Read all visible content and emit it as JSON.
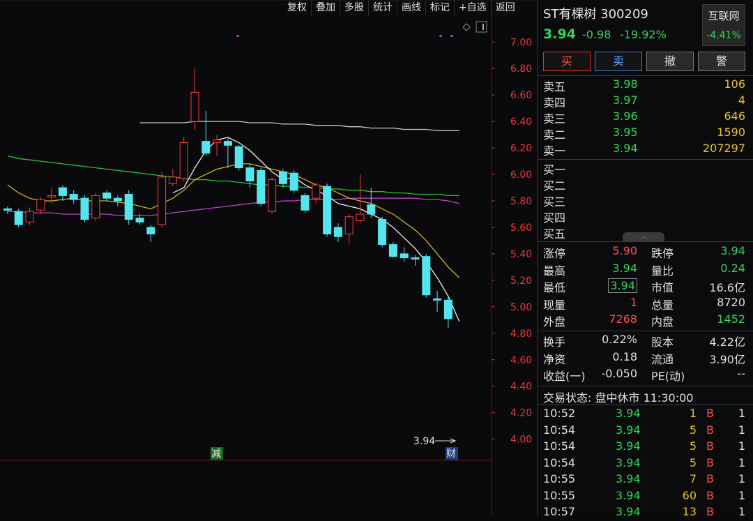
{
  "toolbar": [
    "复权",
    "叠加",
    "多股",
    "统计",
    "画线",
    "标记",
    "+自选",
    "返回"
  ],
  "chart_data": {
    "type": "candlestick",
    "y_ticks": [
      "7.00",
      "6.80",
      "6.60",
      "6.40",
      "6.20",
      "6.00",
      "5.80",
      "5.60",
      "5.40",
      "5.20",
      "5.00",
      "4.80",
      "4.60",
      "4.40",
      "4.20",
      "4.00"
    ],
    "ylim": [
      3.84,
      7.17
    ],
    "last_price_label": "3.94",
    "marker_left": "减",
    "marker_right": "财",
    "candles": [
      {
        "o": 5.74,
        "c": 5.73,
        "h": 5.76,
        "l": 5.7
      },
      {
        "o": 5.72,
        "c": 5.62,
        "h": 5.74,
        "l": 5.6
      },
      {
        "o": 5.64,
        "c": 5.72,
        "h": 5.75,
        "l": 5.62
      },
      {
        "o": 5.73,
        "c": 5.81,
        "h": 5.83,
        "l": 5.7
      },
      {
        "o": 5.83,
        "c": 5.84,
        "h": 5.9,
        "l": 5.78
      },
      {
        "o": 5.9,
        "c": 5.84,
        "h": 5.92,
        "l": 5.8
      },
      {
        "o": 5.85,
        "c": 5.81,
        "h": 5.88,
        "l": 5.78
      },
      {
        "o": 5.82,
        "c": 5.66,
        "h": 5.84,
        "l": 5.64
      },
      {
        "o": 5.67,
        "c": 5.84,
        "h": 5.86,
        "l": 5.65
      },
      {
        "o": 5.86,
        "c": 5.82,
        "h": 5.88,
        "l": 5.8
      },
      {
        "o": 5.82,
        "c": 5.8,
        "h": 5.84,
        "l": 5.76
      },
      {
        "o": 5.85,
        "c": 5.66,
        "h": 5.88,
        "l": 5.62
      },
      {
        "o": 5.67,
        "c": 5.64,
        "h": 5.7,
        "l": 5.62
      },
      {
        "o": 5.6,
        "c": 5.55,
        "h": 5.62,
        "l": 5.49
      },
      {
        "o": 5.62,
        "c": 5.98,
        "h": 6.02,
        "l": 5.6
      },
      {
        "o": 5.93,
        "c": 5.98,
        "h": 6.04,
        "l": 5.91
      },
      {
        "o": 5.97,
        "c": 6.24,
        "h": 6.28,
        "l": 5.95
      },
      {
        "o": 6.4,
        "c": 6.62,
        "h": 6.8,
        "l": 6.34
      },
      {
        "o": 6.25,
        "c": 6.16,
        "h": 6.48,
        "l": 6.14
      },
      {
        "o": 6.24,
        "c": 6.26,
        "h": 6.3,
        "l": 6.14
      },
      {
        "o": 6.25,
        "c": 6.22,
        "h": 6.28,
        "l": 6.05
      },
      {
        "o": 6.21,
        "c": 6.05,
        "h": 6.22,
        "l": 6.03
      },
      {
        "o": 6.05,
        "c": 5.95,
        "h": 6.08,
        "l": 5.9
      },
      {
        "o": 6.03,
        "c": 5.78,
        "h": 6.05,
        "l": 5.76
      },
      {
        "o": 5.72,
        "c": 5.96,
        "h": 5.98,
        "l": 5.7
      },
      {
        "o": 6.02,
        "c": 5.93,
        "h": 6.04,
        "l": 5.9
      },
      {
        "o": 6.01,
        "c": 5.88,
        "h": 6.03,
        "l": 5.86
      },
      {
        "o": 5.84,
        "c": 5.73,
        "h": 5.86,
        "l": 5.71
      },
      {
        "o": 5.82,
        "c": 5.92,
        "h": 5.94,
        "l": 5.78
      },
      {
        "o": 5.91,
        "c": 5.55,
        "h": 5.93,
        "l": 5.53
      },
      {
        "o": 5.6,
        "c": 5.53,
        "h": 5.63,
        "l": 5.49
      },
      {
        "o": 5.55,
        "c": 5.68,
        "h": 5.7,
        "l": 5.48
      },
      {
        "o": 5.65,
        "c": 5.7,
        "h": 6.0,
        "l": 5.63
      },
      {
        "o": 5.77,
        "c": 5.7,
        "h": 5.9,
        "l": 5.67
      },
      {
        "o": 5.66,
        "c": 5.47,
        "h": 5.68,
        "l": 5.45
      },
      {
        "o": 5.47,
        "c": 5.38,
        "h": 5.49,
        "l": 5.37
      },
      {
        "o": 5.4,
        "c": 5.37,
        "h": 5.45,
        "l": 5.34
      },
      {
        "o": 5.37,
        "c": 5.36,
        "h": 5.39,
        "l": 5.31
      },
      {
        "o": 5.38,
        "c": 5.09,
        "h": 5.4,
        "l": 5.07
      },
      {
        "o": 5.06,
        "c": 5.05,
        "h": 5.12,
        "l": 4.96
      },
      {
        "o": 5.05,
        "c": 4.91,
        "h": 5.08,
        "l": 4.84
      }
    ],
    "ma_white": [
      null,
      null,
      null,
      null,
      null,
      null,
      null,
      null,
      null,
      null,
      null,
      null,
      null,
      null,
      null,
      5.86,
      5.9,
      6.05,
      6.18,
      6.26,
      6.28,
      6.24,
      6.18,
      6.1,
      6.02,
      5.96,
      5.98,
      5.92,
      5.88,
      5.84,
      5.78,
      5.76,
      5.74,
      5.7,
      5.66,
      5.6,
      5.52,
      5.44,
      5.34,
      5.22,
      5.08,
      4.89
    ],
    "ma_yellow": [
      5.92,
      5.86,
      5.82,
      5.8,
      5.8,
      5.81,
      5.82,
      5.8,
      5.8,
      5.8,
      5.79,
      5.78,
      5.76,
      5.74,
      5.78,
      5.82,
      5.88,
      5.96,
      6.0,
      6.04,
      6.06,
      6.08,
      6.08,
      6.06,
      6.04,
      6.02,
      6.0,
      5.96,
      5.92,
      5.9,
      5.86,
      5.82,
      5.8,
      5.78,
      5.74,
      5.7,
      5.64,
      5.58,
      5.5,
      5.4,
      5.3,
      5.22
    ],
    "ma_green": [
      6.14,
      6.12,
      6.11,
      6.1,
      6.09,
      6.08,
      6.07,
      6.06,
      6.05,
      6.04,
      6.03,
      6.02,
      6.01,
      6.0,
      5.99,
      5.98,
      5.97,
      5.96,
      5.96,
      5.95,
      5.95,
      5.94,
      5.93,
      5.92,
      5.92,
      5.91,
      5.91,
      5.9,
      5.9,
      5.89,
      5.89,
      5.88,
      5.88,
      5.87,
      5.87,
      5.86,
      5.86,
      5.85,
      5.85,
      5.85,
      5.84,
      5.84
    ],
    "ma_purple": [
      5.72,
      5.72,
      5.71,
      5.71,
      5.71,
      5.7,
      5.7,
      5.7,
      5.7,
      5.7,
      5.69,
      5.69,
      5.69,
      5.69,
      5.7,
      5.71,
      5.72,
      5.73,
      5.74,
      5.75,
      5.76,
      5.77,
      5.78,
      5.79,
      5.79,
      5.8,
      5.8,
      5.81,
      5.81,
      5.81,
      5.81,
      5.82,
      5.82,
      5.82,
      5.82,
      5.82,
      5.82,
      5.82,
      5.81,
      5.81,
      5.8,
      5.78
    ],
    "ma_gray": [
      null,
      null,
      null,
      null,
      null,
      null,
      null,
      null,
      null,
      null,
      null,
      null,
      6.39,
      6.39,
      6.39,
      6.39,
      6.39,
      6.4,
      6.4,
      6.4,
      6.4,
      6.4,
      6.39,
      6.39,
      6.39,
      6.38,
      6.38,
      6.38,
      6.37,
      6.37,
      6.37,
      6.36,
      6.36,
      6.35,
      6.35,
      6.35,
      6.34,
      6.34,
      6.34,
      6.33,
      6.33,
      6.33
    ]
  },
  "quote": {
    "title": "ST有棵树 300209",
    "price": "3.94",
    "change": "-0.98",
    "pct": "-19.92%",
    "sector": "互联网",
    "sector_pct": "-4.41%",
    "buttons": [
      "买",
      "卖",
      "撤",
      "警"
    ]
  },
  "asks": [
    {
      "label": "卖五",
      "price": "3.98",
      "vol": "106"
    },
    {
      "label": "卖四",
      "price": "3.97",
      "vol": "4"
    },
    {
      "label": "卖三",
      "price": "3.96",
      "vol": "646"
    },
    {
      "label": "卖二",
      "price": "3.95",
      "vol": "1590"
    },
    {
      "label": "卖一",
      "price": "3.94",
      "vol": "207297"
    }
  ],
  "bids": [
    {
      "label": "买一",
      "price": "",
      "vol": ""
    },
    {
      "label": "买二",
      "price": "",
      "vol": ""
    },
    {
      "label": "买三",
      "price": "",
      "vol": ""
    },
    {
      "label": "买四",
      "price": "",
      "vol": ""
    },
    {
      "label": "买五",
      "price": "",
      "vol": ""
    }
  ],
  "stats": [
    {
      "l1": "涨停",
      "v1": "5.90",
      "c1": "red",
      "l2": "跌停",
      "v2": "3.94",
      "c2": "green"
    },
    {
      "l1": "最高",
      "v1": "3.94",
      "c1": "green",
      "l2": "量比",
      "v2": "0.24",
      "c2": "green"
    },
    {
      "l1": "最低",
      "v1": "3.94",
      "c1": "green",
      "l2": "市值",
      "v2": "16.6亿",
      "c2": "white"
    },
    {
      "l1": "现量",
      "v1": "1",
      "c1": "red",
      "l2": "总量",
      "v2": "8720",
      "c2": "white"
    },
    {
      "l1": "外盘",
      "v1": "7268",
      "c1": "red",
      "l2": "内盘",
      "v2": "1452",
      "c2": "green"
    }
  ],
  "stats2": [
    {
      "l1": "换手",
      "v1": "0.22%",
      "l2": "股本",
      "v2": "4.22亿"
    },
    {
      "l1": "净资",
      "v1": "0.18",
      "l2": "流通",
      "v2": "3.90亿"
    },
    {
      "l1": "收益(一)",
      "v1": "-0.050",
      "l2": "PE(动)",
      "v2": "--"
    }
  ],
  "status": "交易状态: 盘中休市 11:30:00",
  "ticks": [
    {
      "t": "10:52",
      "p": "3.94",
      "v": "1",
      "s": "B",
      "n": "1"
    },
    {
      "t": "10:54",
      "p": "3.94",
      "v": "5",
      "s": "B",
      "n": "1"
    },
    {
      "t": "10:54",
      "p": "3.94",
      "v": "5",
      "s": "B",
      "n": "1"
    },
    {
      "t": "10:54",
      "p": "3.94",
      "v": "5",
      "s": "B",
      "n": "1"
    },
    {
      "t": "10:55",
      "p": "3.94",
      "v": "7",
      "s": "B",
      "n": "1"
    },
    {
      "t": "10:55",
      "p": "3.94",
      "v": "60",
      "s": "B",
      "n": "1"
    },
    {
      "t": "10:57",
      "p": "3.94",
      "v": "13",
      "s": "B",
      "n": "1"
    }
  ]
}
